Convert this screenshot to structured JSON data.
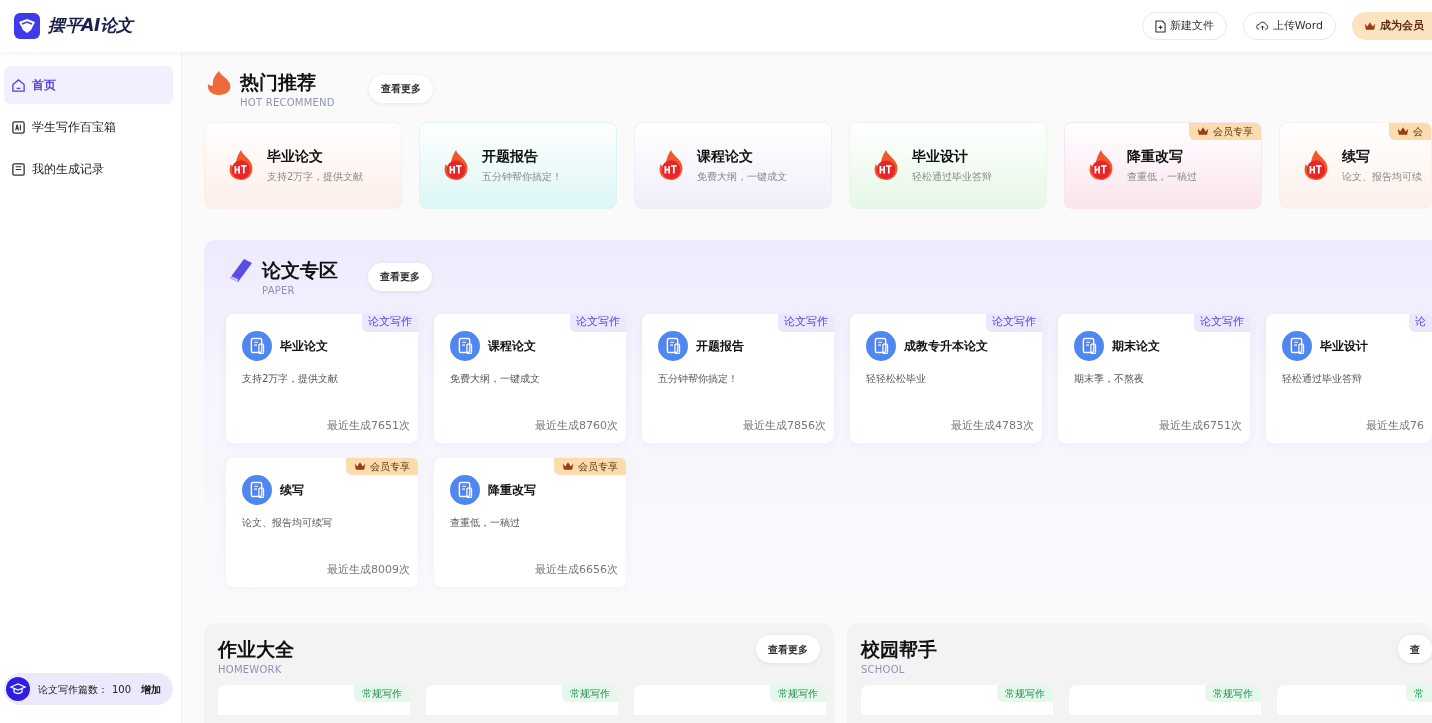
{
  "header": {
    "logo_text": "摆平AI论文",
    "buttons": [
      {
        "kind": "new-file",
        "label": "新建文件"
      },
      {
        "kind": "upload",
        "label": "上传Word"
      },
      {
        "kind": "vip",
        "label": "成为会员"
      }
    ]
  },
  "sidebar": {
    "items": [
      {
        "kind": "home",
        "label": "首页",
        "selected": true
      },
      {
        "kind": "toolbox",
        "label": "学生写作百宝箱",
        "selected": false
      },
      {
        "kind": "records",
        "label": "我的生成记录",
        "selected": false
      }
    ],
    "quota": {
      "label": "论文写作篇数：",
      "value": "100",
      "action": "增加"
    }
  },
  "hot": {
    "title": "热门推荐",
    "subtitle": "HOT RECOMMEND",
    "more": "查看更多",
    "cards": [
      {
        "title": "毕业论文",
        "desc": "支持2万字，提供文献",
        "color": "#fdeee8"
      },
      {
        "title": "开题报告",
        "desc": "五分钟帮你搞定！",
        "color": "#dcf6f6"
      },
      {
        "title": "课程论文",
        "desc": "免费大纲，一键成文",
        "color": "#f1eefb"
      },
      {
        "title": "毕业设计",
        "desc": "轻松通过毕业答辩",
        "color": "#e6f7e6"
      },
      {
        "title": "降重改写",
        "desc": "查重低，一稿过",
        "color": "#fbe4ef",
        "badge": "会员专享"
      },
      {
        "title": "续写",
        "desc": "论文、报告均可续",
        "color": "#fdf0ea",
        "badge": "会"
      }
    ]
  },
  "paper": {
    "title": "论文专区",
    "subtitle": "PAPER",
    "more": "查看更多",
    "cards": [
      {
        "title": "毕业论文",
        "desc": "支持2万字，提供文献",
        "tag": "论文写作",
        "kind": "normal",
        "count": "最近生成7651次"
      },
      {
        "title": "课程论文",
        "desc": "免费大纲，一键成文",
        "tag": "论文写作",
        "kind": "normal",
        "count": "最近生成8760次"
      },
      {
        "title": "开题报告",
        "desc": "五分钟帮你搞定！",
        "tag": "论文写作",
        "kind": "normal",
        "count": "最近生成7856次"
      },
      {
        "title": "成教专升本论文",
        "desc": "轻轻松松毕业",
        "tag": "论文写作",
        "kind": "normal",
        "count": "最近生成4783次"
      },
      {
        "title": "期末论文",
        "desc": "期末季，不熬夜",
        "tag": "论文写作",
        "kind": "normal",
        "count": "最近生成6751次"
      },
      {
        "title": "毕业设计",
        "desc": "轻松通过毕业答辩",
        "tag": "论",
        "kind": "normal",
        "count": "最近生成76"
      },
      {
        "title": "续写",
        "desc": "论文、报告均可续写",
        "tag": "会员专享",
        "kind": "vip",
        "count": "最近生成8009次"
      },
      {
        "title": "降重改写",
        "desc": "查重低，一稿过",
        "tag": "会员专享",
        "kind": "vip",
        "count": "最近生成6656次"
      }
    ]
  },
  "homework": {
    "title": "作业大全",
    "subtitle": "HOMEWORK",
    "more": "查看更多",
    "cards": [
      {
        "tag": "常规写作"
      },
      {
        "tag": "常规写作"
      },
      {
        "tag": "常规写作"
      }
    ]
  },
  "school": {
    "title": "校园帮手",
    "subtitle": "SCHOOL",
    "more": "查",
    "cards": [
      {
        "tag": "常规写作"
      },
      {
        "tag": "常规写作"
      },
      {
        "tag": "常"
      }
    ]
  }
}
